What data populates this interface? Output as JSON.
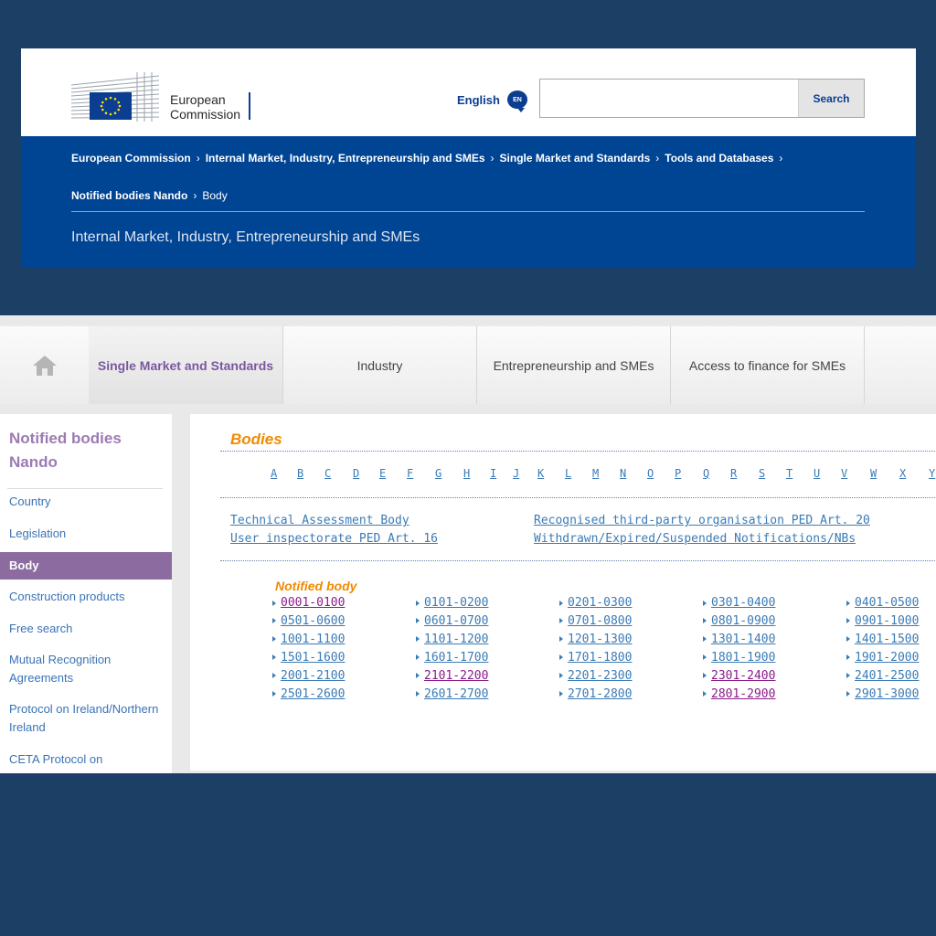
{
  "header": {
    "logo_text_line1": "European",
    "logo_text_line2": "Commission",
    "language_label": "English",
    "language_code": "EN",
    "search_value": "",
    "search_placeholder": "",
    "search_button_label": "Search"
  },
  "breadcrumb": [
    {
      "label": "European Commission"
    },
    {
      "label": "Internal Market, Industry, Entrepreneurship and SMEs"
    },
    {
      "label": "Single Market and Standards"
    },
    {
      "label": "Tools and Databases"
    },
    {
      "label": "Notified bodies Nando"
    },
    {
      "label": "Body"
    }
  ],
  "site_name": "Internal Market, Industry, Entrepreneurship and SMEs",
  "nav": {
    "home_icon": "home-icon",
    "tabs": [
      {
        "label": "Single Market and Standards",
        "active": true
      },
      {
        "label": "Industry",
        "active": false
      },
      {
        "label": "Entrepreneurship and SMEs",
        "active": false
      },
      {
        "label": "Access to finance for SMEs",
        "active": false
      }
    ]
  },
  "sidebar": {
    "title": "Notified bodies Nando",
    "items": [
      {
        "label": "Country",
        "active": false
      },
      {
        "label": "Legislation",
        "active": false
      },
      {
        "label": "Body",
        "active": true
      },
      {
        "label": "Construction products",
        "active": false
      },
      {
        "label": "Free search",
        "active": false
      },
      {
        "label": "Mutual Recognition Agreements",
        "active": false
      },
      {
        "label": "Protocol on Ireland/Northern Ireland",
        "active": false
      },
      {
        "label": "CETA Protocol on",
        "active": false
      }
    ]
  },
  "content": {
    "title": "Bodies",
    "alphabet": [
      "A",
      "B",
      "C",
      "D",
      "E",
      "F",
      "G",
      "H",
      "I",
      "J",
      "K",
      "L",
      "M",
      "N",
      "O",
      "P",
      "Q",
      "R",
      "S",
      "T",
      "U",
      "V",
      "W",
      "X",
      "Y"
    ],
    "links": [
      {
        "label": "Technical Assessment Body"
      },
      {
        "label": "Recognised third-party organisation PED Art. 20"
      },
      {
        "label": "User inspectorate PED Art. 16"
      },
      {
        "label": "Withdrawn/Expired/Suspended Notifications/NBs"
      }
    ],
    "subtitle": "Notified body",
    "ranges": [
      [
        {
          "label": "0001-0100",
          "visited": true
        },
        {
          "label": "0101-0200",
          "visited": false
        },
        {
          "label": "0201-0300",
          "visited": false
        },
        {
          "label": "0301-0400",
          "visited": false
        },
        {
          "label": "0401-0500",
          "visited": false
        }
      ],
      [
        {
          "label": "0501-0600",
          "visited": false
        },
        {
          "label": "0601-0700",
          "visited": false
        },
        {
          "label": "0701-0800",
          "visited": false
        },
        {
          "label": "0801-0900",
          "visited": false
        },
        {
          "label": "0901-1000",
          "visited": false
        }
      ],
      [
        {
          "label": "1001-1100",
          "visited": false
        },
        {
          "label": "1101-1200",
          "visited": false
        },
        {
          "label": "1201-1300",
          "visited": false
        },
        {
          "label": "1301-1400",
          "visited": false
        },
        {
          "label": "1401-1500",
          "visited": false
        }
      ],
      [
        {
          "label": "1501-1600",
          "visited": false
        },
        {
          "label": "1601-1700",
          "visited": false
        },
        {
          "label": "1701-1800",
          "visited": false
        },
        {
          "label": "1801-1900",
          "visited": false
        },
        {
          "label": "1901-2000",
          "visited": false
        }
      ],
      [
        {
          "label": "2001-2100",
          "visited": false
        },
        {
          "label": "2101-2200",
          "visited": true
        },
        {
          "label": "2201-2300",
          "visited": false
        },
        {
          "label": "2301-2400",
          "visited": true
        },
        {
          "label": "2401-2500",
          "visited": false
        }
      ],
      [
        {
          "label": "2501-2600",
          "visited": false
        },
        {
          "label": "2601-2700",
          "visited": false
        },
        {
          "label": "2701-2800",
          "visited": false
        },
        {
          "label": "2801-2900",
          "visited": true
        },
        {
          "label": "2901-3000",
          "visited": false
        }
      ]
    ]
  },
  "colors": {
    "background": "#1c3f66",
    "ec_blue": "#004494",
    "accent_purple": "#8b6ba0",
    "orange": "#f08a00",
    "link": "#3b7bb5",
    "visited": "#8b1a8b"
  }
}
